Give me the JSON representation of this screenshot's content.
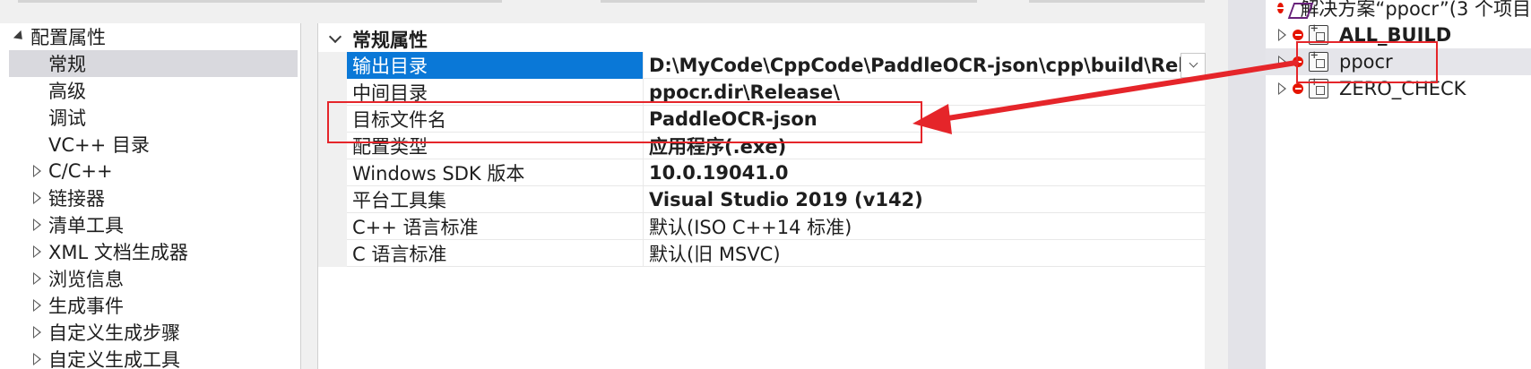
{
  "tree": {
    "root": "配置属性",
    "items": [
      {
        "label": "常规",
        "selected": true,
        "expandable": false
      },
      {
        "label": "高级",
        "expandable": false
      },
      {
        "label": "调试",
        "expandable": false
      },
      {
        "label": "VC++ 目录",
        "expandable": false
      },
      {
        "label": "C/C++",
        "expandable": true
      },
      {
        "label": "链接器",
        "expandable": true
      },
      {
        "label": "清单工具",
        "expandable": true
      },
      {
        "label": "XML 文档生成器",
        "expandable": true
      },
      {
        "label": "浏览信息",
        "expandable": true
      },
      {
        "label": "生成事件",
        "expandable": true
      },
      {
        "label": "自定义生成步骤",
        "expandable": true
      },
      {
        "label": "自定义生成工具",
        "expandable": true
      }
    ]
  },
  "grid": {
    "section": "常规属性",
    "rows": [
      {
        "name": "输出目录",
        "value": "D:\\MyCode\\CppCode\\PaddleOCR-json\\cpp\\build\\Relea",
        "bold": true,
        "selected": true
      },
      {
        "name": "中间目录",
        "value": "ppocr.dir\\Release\\",
        "bold": true
      },
      {
        "name": "目标文件名",
        "value": "PaddleOCR-json",
        "bold": true
      },
      {
        "name": "配置类型",
        "value": "应用程序(.exe)",
        "bold": true
      },
      {
        "name": "Windows SDK 版本",
        "value": "10.0.19041.0",
        "bold": true
      },
      {
        "name": "平台工具集",
        "value": "Visual Studio 2019 (v142)",
        "bold": true
      },
      {
        "name": "C++ 语言标准",
        "value": "默认(ISO C++14 标准)",
        "bold": false
      },
      {
        "name": "C 语言标准",
        "value": "默认(旧 MSVC)",
        "bold": false
      }
    ]
  },
  "solution_explorer": {
    "solution_label": "解决方案“ppocr”(3 个项目",
    "projects": [
      {
        "name": "ALL_BUILD",
        "bold": true
      },
      {
        "name": "ppocr",
        "bold": false
      },
      {
        "name": "ZERO_CHECK",
        "bold": false
      }
    ]
  },
  "colors": {
    "selection_blue": "#0a78d7",
    "annotation_red": "#e5252a",
    "error_badge": "#e51400"
  }
}
